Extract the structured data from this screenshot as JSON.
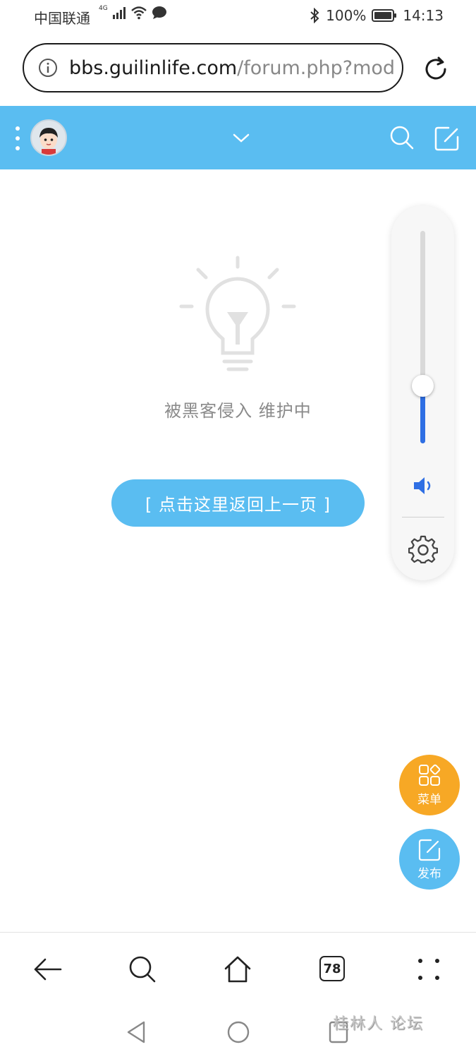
{
  "status_bar": {
    "carrier": "中国联通",
    "network_tag": "4G",
    "battery": "100%",
    "time": "14:13",
    "icons": [
      "signal-icon",
      "wifi-icon",
      "message-icon",
      "bluetooth-icon",
      "battery-icon"
    ]
  },
  "url_bar": {
    "host": "bbs.guilinlife.com",
    "path": "/forum.php?mod"
  },
  "forum_header": {
    "background_color": "#5abdf1"
  },
  "main": {
    "message": "被黑客侵入 维护中",
    "back_button_label": "[ 点击这里返回上一页 ]"
  },
  "volume_panel": {
    "level": 0.27,
    "fill_color": "#2f6fe4"
  },
  "fabs": {
    "menu_label": "菜单",
    "menu_color": "#f7a825",
    "post_label": "发布",
    "post_color": "#5abdf1"
  },
  "bottom_nav": {
    "tabs_count": "78"
  },
  "watermark": {
    "text": "桂林人 论坛"
  }
}
